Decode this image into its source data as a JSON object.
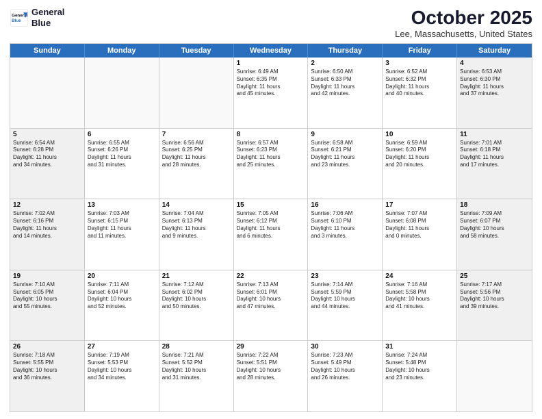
{
  "logo": {
    "line1": "General",
    "line2": "Blue"
  },
  "title": "October 2025",
  "location": "Lee, Massachusetts, United States",
  "days_header": [
    "Sunday",
    "Monday",
    "Tuesday",
    "Wednesday",
    "Thursday",
    "Friday",
    "Saturday"
  ],
  "rows": [
    [
      {
        "num": "",
        "text": "",
        "empty": true
      },
      {
        "num": "",
        "text": "",
        "empty": true
      },
      {
        "num": "",
        "text": "",
        "empty": true
      },
      {
        "num": "1",
        "text": "Sunrise: 6:49 AM\nSunset: 6:35 PM\nDaylight: 11 hours\nand 45 minutes.",
        "shaded": false
      },
      {
        "num": "2",
        "text": "Sunrise: 6:50 AM\nSunset: 6:33 PM\nDaylight: 11 hours\nand 42 minutes.",
        "shaded": false
      },
      {
        "num": "3",
        "text": "Sunrise: 6:52 AM\nSunset: 6:32 PM\nDaylight: 11 hours\nand 40 minutes.",
        "shaded": false
      },
      {
        "num": "4",
        "text": "Sunrise: 6:53 AM\nSunset: 6:30 PM\nDaylight: 11 hours\nand 37 minutes.",
        "shaded": true
      }
    ],
    [
      {
        "num": "5",
        "text": "Sunrise: 6:54 AM\nSunset: 6:28 PM\nDaylight: 11 hours\nand 34 minutes.",
        "shaded": true
      },
      {
        "num": "6",
        "text": "Sunrise: 6:55 AM\nSunset: 6:26 PM\nDaylight: 11 hours\nand 31 minutes.",
        "shaded": false
      },
      {
        "num": "7",
        "text": "Sunrise: 6:56 AM\nSunset: 6:25 PM\nDaylight: 11 hours\nand 28 minutes.",
        "shaded": false
      },
      {
        "num": "8",
        "text": "Sunrise: 6:57 AM\nSunset: 6:23 PM\nDaylight: 11 hours\nand 25 minutes.",
        "shaded": false
      },
      {
        "num": "9",
        "text": "Sunrise: 6:58 AM\nSunset: 6:21 PM\nDaylight: 11 hours\nand 23 minutes.",
        "shaded": false
      },
      {
        "num": "10",
        "text": "Sunrise: 6:59 AM\nSunset: 6:20 PM\nDaylight: 11 hours\nand 20 minutes.",
        "shaded": false
      },
      {
        "num": "11",
        "text": "Sunrise: 7:01 AM\nSunset: 6:18 PM\nDaylight: 11 hours\nand 17 minutes.",
        "shaded": true
      }
    ],
    [
      {
        "num": "12",
        "text": "Sunrise: 7:02 AM\nSunset: 6:16 PM\nDaylight: 11 hours\nand 14 minutes.",
        "shaded": true
      },
      {
        "num": "13",
        "text": "Sunrise: 7:03 AM\nSunset: 6:15 PM\nDaylight: 11 hours\nand 11 minutes.",
        "shaded": false
      },
      {
        "num": "14",
        "text": "Sunrise: 7:04 AM\nSunset: 6:13 PM\nDaylight: 11 hours\nand 9 minutes.",
        "shaded": false
      },
      {
        "num": "15",
        "text": "Sunrise: 7:05 AM\nSunset: 6:12 PM\nDaylight: 11 hours\nand 6 minutes.",
        "shaded": false
      },
      {
        "num": "16",
        "text": "Sunrise: 7:06 AM\nSunset: 6:10 PM\nDaylight: 11 hours\nand 3 minutes.",
        "shaded": false
      },
      {
        "num": "17",
        "text": "Sunrise: 7:07 AM\nSunset: 6:08 PM\nDaylight: 11 hours\nand 0 minutes.",
        "shaded": false
      },
      {
        "num": "18",
        "text": "Sunrise: 7:09 AM\nSunset: 6:07 PM\nDaylight: 10 hours\nand 58 minutes.",
        "shaded": true
      }
    ],
    [
      {
        "num": "19",
        "text": "Sunrise: 7:10 AM\nSunset: 6:05 PM\nDaylight: 10 hours\nand 55 minutes.",
        "shaded": true
      },
      {
        "num": "20",
        "text": "Sunrise: 7:11 AM\nSunset: 6:04 PM\nDaylight: 10 hours\nand 52 minutes.",
        "shaded": false
      },
      {
        "num": "21",
        "text": "Sunrise: 7:12 AM\nSunset: 6:02 PM\nDaylight: 10 hours\nand 50 minutes.",
        "shaded": false
      },
      {
        "num": "22",
        "text": "Sunrise: 7:13 AM\nSunset: 6:01 PM\nDaylight: 10 hours\nand 47 minutes.",
        "shaded": false
      },
      {
        "num": "23",
        "text": "Sunrise: 7:14 AM\nSunset: 5:59 PM\nDaylight: 10 hours\nand 44 minutes.",
        "shaded": false
      },
      {
        "num": "24",
        "text": "Sunrise: 7:16 AM\nSunset: 5:58 PM\nDaylight: 10 hours\nand 41 minutes.",
        "shaded": false
      },
      {
        "num": "25",
        "text": "Sunrise: 7:17 AM\nSunset: 5:56 PM\nDaylight: 10 hours\nand 39 minutes.",
        "shaded": true
      }
    ],
    [
      {
        "num": "26",
        "text": "Sunrise: 7:18 AM\nSunset: 5:55 PM\nDaylight: 10 hours\nand 36 minutes.",
        "shaded": true
      },
      {
        "num": "27",
        "text": "Sunrise: 7:19 AM\nSunset: 5:53 PM\nDaylight: 10 hours\nand 34 minutes.",
        "shaded": false
      },
      {
        "num": "28",
        "text": "Sunrise: 7:21 AM\nSunset: 5:52 PM\nDaylight: 10 hours\nand 31 minutes.",
        "shaded": false
      },
      {
        "num": "29",
        "text": "Sunrise: 7:22 AM\nSunset: 5:51 PM\nDaylight: 10 hours\nand 28 minutes.",
        "shaded": false
      },
      {
        "num": "30",
        "text": "Sunrise: 7:23 AM\nSunset: 5:49 PM\nDaylight: 10 hours\nand 26 minutes.",
        "shaded": false
      },
      {
        "num": "31",
        "text": "Sunrise: 7:24 AM\nSunset: 5:48 PM\nDaylight: 10 hours\nand 23 minutes.",
        "shaded": false
      },
      {
        "num": "",
        "text": "",
        "empty": true
      }
    ]
  ]
}
